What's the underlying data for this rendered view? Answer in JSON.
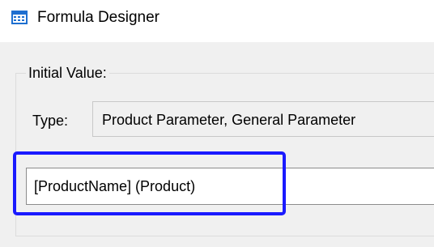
{
  "window": {
    "title": "Formula Designer",
    "icon": "formula-designer-app-icon"
  },
  "initial_value": {
    "group_label": "Initial Value:",
    "type_label": "Type:",
    "type_value": "Product Parameter, General Parameter",
    "value": "[ProductName]  (Product)"
  },
  "colors": {
    "highlight": "#1a1aff",
    "icon_blue": "#1e6fd0",
    "background": "#f0f0f0"
  }
}
